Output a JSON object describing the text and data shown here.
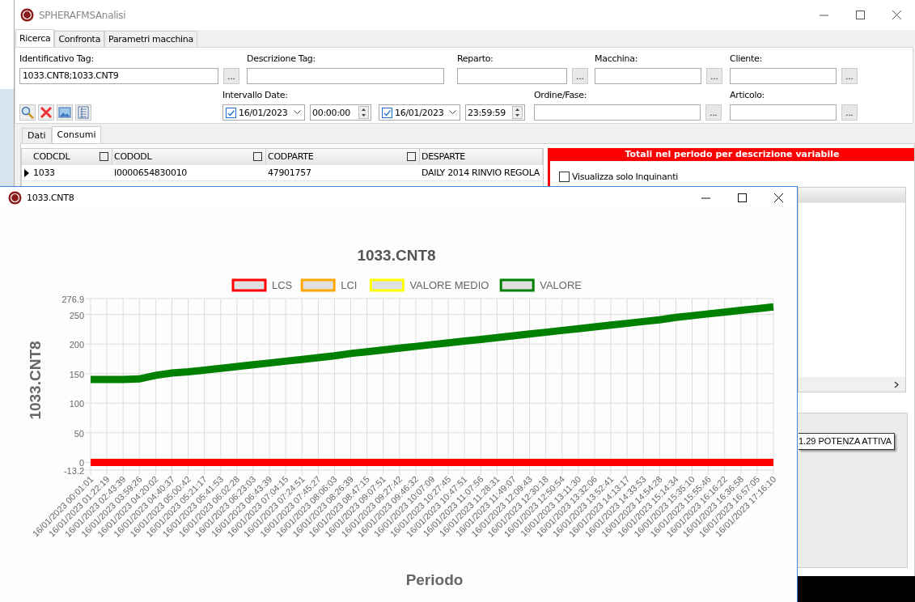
{
  "window": {
    "title": "SPHERAFMSAnalisi"
  },
  "tabs": [
    {
      "label": "Ricerca",
      "selected": true
    },
    {
      "label": "Confronta",
      "selected": false
    },
    {
      "label": "Parametri macchina",
      "selected": false
    }
  ],
  "filters_row1": [
    {
      "label": "Identificativo Tag:",
      "value": "1033.CNT8;1033.CNT9",
      "button": "..."
    },
    {
      "label": "Descrizione Tag:"
    },
    {
      "label": "Reparto:",
      "button": "..."
    },
    {
      "label": "Macchina:",
      "button": "..."
    },
    {
      "label": "Cliente:",
      "button": "..."
    }
  ],
  "date_range": {
    "label": "Intervallo Date:",
    "from": {
      "checked": true,
      "date": "16/01/2023",
      "time": "00:00:00"
    },
    "to": {
      "checked": true,
      "date": "16/01/2023",
      "time": "23:59:59"
    }
  },
  "filters_row2": [
    {
      "label": "Ordine/Fase:",
      "button": "..."
    },
    {
      "label": "Articolo:",
      "button": "..."
    }
  ],
  "lower_tabs": [
    {
      "label": "Dati",
      "selected": false
    },
    {
      "label": "Consumi",
      "selected": true
    }
  ],
  "grid": {
    "columns": [
      "CODCDL",
      "CODODL",
      "CODPARTE",
      "DESPARTE"
    ],
    "rows": [
      {
        "selected": true,
        "cells": [
          "1033",
          "I0000654830010",
          "47901757",
          "DAILY 2014 RINVIO REGOLA"
        ]
      }
    ]
  },
  "totals_panel": {
    "title": "Totali nel periodo per descrizione variabile",
    "only_pollutants": {
      "label": "Visualizza solo Inquinanti",
      "checked": false
    }
  },
  "tooltip": "1.29 POTENZA ATTIVA",
  "chart_window": {
    "title": "1033.CNT8",
    "chart_data": {
      "type": "line",
      "title": "1033.CNT8",
      "xlabel": "Periodo",
      "ylabel": "1033.CNT8",
      "categories": [
        "16/01/2023 00:01:01",
        "16/01/2023 01:22:19",
        "16/01/2023 02:43:39",
        "16/01/2023 03:59:26",
        "16/01/2023 04:20:02",
        "16/01/2023 04:40:37",
        "16/01/2023 05:00:42",
        "16/01/2023 05:21:17",
        "16/01/2023 05:41:53",
        "16/01/2023 06:02:28",
        "16/01/2023 06:23:03",
        "16/01/2023 06:43:39",
        "16/01/2023 07:04:15",
        "16/01/2023 07:24:51",
        "16/01/2023 07:45:27",
        "16/01/2023 08:06:03",
        "16/01/2023 08:26:39",
        "16/01/2023 08:47:15",
        "16/01/2023 09:07:51",
        "16/01/2023 09:27:42",
        "16/01/2023 09:46:32",
        "16/01/2023 10:07:09",
        "16/01/2023 10:27:45",
        "16/01/2023 10:47:51",
        "16/01/2023 11:07:56",
        "16/01/2023 11:28:31",
        "16/01/2023 11:49:07",
        "16/01/2023 12:09:43",
        "16/01/2023 12:30:18",
        "16/01/2023 12:50:54",
        "16/01/2023 13:11:30",
        "16/01/2023 13:32:06",
        "16/01/2023 13:52:41",
        "16/01/2023 14:13:17",
        "16/01/2023 14:33:53",
        "16/01/2023 14:54:28",
        "16/01/2023 15:14:34",
        "16/01/2023 15:35:10",
        "16/01/2023 15:55:46",
        "16/01/2023 16:16:22",
        "16/01/2023 16:36:58",
        "16/01/2023 16:57:05",
        "16/01/2023 17:16:10"
      ],
      "series": [
        {
          "name": "LCS",
          "color": "#ff0000",
          "values": [
            0,
            0,
            0,
            0,
            0,
            0,
            0,
            0,
            0,
            0,
            0,
            0,
            0,
            0,
            0,
            0,
            0,
            0,
            0,
            0,
            0,
            0,
            0,
            0,
            0,
            0,
            0,
            0,
            0,
            0,
            0,
            0,
            0,
            0,
            0,
            0,
            0,
            0,
            0,
            0,
            0,
            0,
            0
          ]
        },
        {
          "name": "LCI",
          "color": "#ffa500",
          "values": [
            null,
            null,
            null,
            null,
            null,
            null,
            null,
            null,
            null,
            null,
            null,
            null,
            null,
            null,
            null,
            null,
            null,
            null,
            null,
            null,
            null,
            null,
            null,
            null,
            null,
            null,
            null,
            null,
            null,
            null,
            null,
            null,
            null,
            null,
            null,
            null,
            null,
            null,
            null,
            null,
            null,
            null,
            null
          ]
        },
        {
          "name": "VALORE MEDIO",
          "color": "#ffff00",
          "values": [
            null,
            null,
            null,
            null,
            null,
            null,
            null,
            null,
            null,
            null,
            null,
            null,
            null,
            null,
            null,
            null,
            null,
            null,
            null,
            null,
            null,
            null,
            null,
            null,
            null,
            null,
            null,
            null,
            null,
            null,
            null,
            null,
            null,
            null,
            null,
            null,
            null,
            null,
            null,
            null,
            null,
            null,
            null
          ]
        },
        {
          "name": "VALORE",
          "color": "#008000",
          "values": [
            140,
            140,
            140,
            141,
            147,
            151,
            153,
            156,
            159,
            162,
            165,
            168,
            171,
            174,
            177,
            180,
            184,
            187,
            190,
            193,
            196,
            199,
            202,
            205,
            208,
            211,
            214,
            217,
            220,
            223,
            226,
            229,
            232,
            235,
            238,
            241,
            245,
            248,
            251,
            254,
            257,
            260,
            263
          ]
        }
      ],
      "grid": true,
      "legend": true,
      "ylim": [
        -13.2,
        276.9
      ],
      "yticks": [
        -13.2,
        0,
        50,
        100,
        150,
        200,
        250,
        276.9
      ]
    }
  }
}
